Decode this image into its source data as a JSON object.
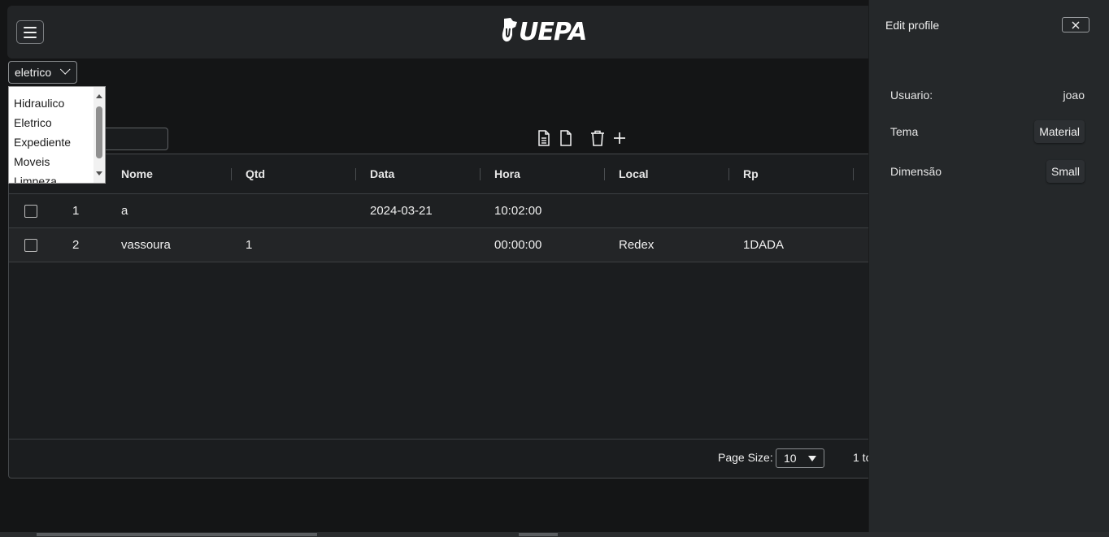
{
  "header": {
    "logo_text": "UEPA",
    "menu_icon": "hamburger-icon"
  },
  "category_select": {
    "value": "eletrico",
    "options": [
      "Hidraulico",
      "Eletrico",
      "Expediente",
      "Moveis",
      "Limpeza"
    ]
  },
  "toolbar": {
    "search_value": "",
    "icons": [
      "file-text-icon",
      "file-icon",
      "trash-icon",
      "plus-icon"
    ]
  },
  "grid": {
    "columns": [
      "Nome",
      "Qtd",
      "Data",
      "Hora",
      "Local",
      "Rp"
    ],
    "rows": [
      {
        "id": "1",
        "nome": "a",
        "qtd": "",
        "data": "2024-03-21",
        "hora": "10:02:00",
        "local": "",
        "rp": "",
        "extra": ""
      },
      {
        "id": "2",
        "nome": "vassoura",
        "qtd": "1",
        "data": "",
        "hora": "00:00:00",
        "local": "Redex",
        "rp": "1DADA",
        "extra": "."
      }
    ],
    "footer": {
      "page_size_label": "Page Size:",
      "page_size_value": "10",
      "pagination_text": "1 to"
    }
  },
  "profile_panel": {
    "title": "Edit profile",
    "fields": {
      "usuario_label": "Usuario:",
      "usuario_value": "joao",
      "tema_label": "Tema",
      "tema_value": "Material",
      "dimensao_label": "Dimensão",
      "dimensao_value": "Small"
    }
  },
  "colors": {
    "background": "#141516",
    "surface": "#222426",
    "panel": "#25282a",
    "text": "#f0f0f0"
  }
}
